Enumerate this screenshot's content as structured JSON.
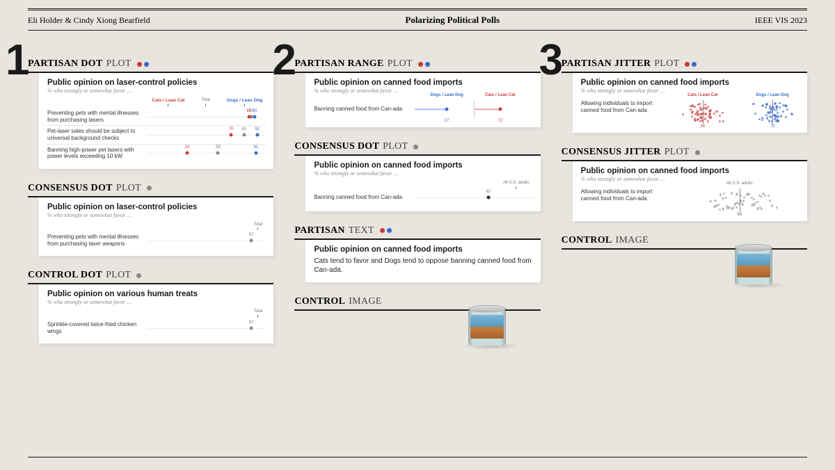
{
  "header": {
    "authors": "Eli Holder & Cindy Xiong Bearfield",
    "title": "Polarizing Political Polls",
    "venue": "IEEE VIS 2023"
  },
  "legend": {
    "red": "Cats / Lean Cat",
    "blue": "Dogs / Lean Dog",
    "total": "Total",
    "all_adults": "All U.S. adults"
  },
  "subtext": "% who strongly or somewhat favor …",
  "col1": {
    "num": "1",
    "s1": {
      "title_bold": "PARTISAN DOT",
      "title_light": "PLOT",
      "card_title": "Public opinion on laser-control policies",
      "rows": [
        {
          "label": "Preventing pets with mental illnesses from purchasing lasers",
          "red": 85,
          "blue": 90,
          "grey": 87
        },
        {
          "label": "Pet-laser sales should be subject to universal background checks",
          "red": 70,
          "blue": 92,
          "grey": 81
        },
        {
          "label": "Banning high-power pet lasers with power levels exceeding 10 kW",
          "red": 33,
          "blue": 91,
          "grey": 59
        }
      ]
    },
    "s2": {
      "title_bold": "CONSENSUS DOT",
      "title_light": "PLOT",
      "card_title": "Public opinion on laser-control policies",
      "row": {
        "label": "Preventing pets with mental illnesses from purchasing laser weapons",
        "grey": 87
      }
    },
    "s3": {
      "title_bold": "CONTROL DOT",
      "title_light": "PLOT",
      "card_title": "Public opinion on various human treats",
      "row": {
        "label": "Sprinkle-covered twice-fried chicken wings",
        "grey": 87
      }
    }
  },
  "col2": {
    "num": "2",
    "s1": {
      "title_bold": "PARTISAN RANGE",
      "title_light": "PLOT",
      "card_title": "Public opinion on canned food imports",
      "row": {
        "label": "Banning canned food from Can-ada",
        "red": 72,
        "blue": 27
      }
    },
    "s2": {
      "title_bold": "CONSENSUS DOT",
      "title_light": "PLOT",
      "card_title": "Public opinion on canned food imports",
      "row": {
        "label": "Banning canned food from Can-ada",
        "grey": 62
      }
    },
    "s3": {
      "title_bold": "PARTISAN",
      "title_light": "TEXT",
      "card_title": "Public opinion on canned food imports",
      "text": "Cats tend to favor and Dogs tend to oppose banning canned food from Can-ada."
    },
    "s4": {
      "title_bold": "CONTROL",
      "title_light": "IMAGE"
    }
  },
  "col3": {
    "num": "3",
    "s1": {
      "title_bold": "PARTISAN JITTER",
      "title_light": "PLOT",
      "card_title": "Public opinion on canned food imports",
      "row": {
        "label": "Allowing individuals to import canned food from Can-ada",
        "red": 26,
        "blue": 79
      }
    },
    "s2": {
      "title_bold": "CONSENSUS JITTER",
      "title_light": "PLOT",
      "card_title": "Public opinion on canned food imports",
      "row": {
        "label": "Allowing individuals to import canned food from Can-ada",
        "grey": 54
      }
    },
    "s3": {
      "title_bold": "CONTROL",
      "title_light": "IMAGE"
    }
  },
  "chart_data": [
    {
      "type": "scatter",
      "name": "Partisan Dot Plot – laser-control",
      "title": "Public opinion on laser-control policies",
      "ylabel": "",
      "xlabel": "% who strongly or somewhat favor",
      "xlim": [
        0,
        100
      ],
      "categories": [
        "Preventing pets with mental illnesses from purchasing lasers",
        "Pet-laser sales should be subject to universal background checks",
        "Banning high-power pet lasers with power levels exceeding 10 kW"
      ],
      "series": [
        {
          "name": "Cats / Lean Cat",
          "values": [
            85,
            70,
            33
          ]
        },
        {
          "name": "Dogs / Lean Dog",
          "values": [
            90,
            92,
            91
          ]
        },
        {
          "name": "Total",
          "values": [
            87,
            81,
            59
          ]
        }
      ]
    },
    {
      "type": "scatter",
      "name": "Consensus Dot Plot – laser-control",
      "title": "Public opinion on laser-control policies",
      "xlim": [
        0,
        100
      ],
      "categories": [
        "Preventing pets with mental illnesses from purchasing laser weapons"
      ],
      "series": [
        {
          "name": "Total",
          "values": [
            87
          ]
        }
      ]
    },
    {
      "type": "scatter",
      "name": "Control Dot Plot – human treats",
      "title": "Public opinion on various human treats",
      "xlim": [
        0,
        100
      ],
      "categories": [
        "Sprinkle-covered twice-fried chicken wings"
      ],
      "series": [
        {
          "name": "Total",
          "values": [
            87
          ]
        }
      ]
    },
    {
      "type": "bar",
      "name": "Partisan Range Plot – canned food",
      "title": "Public opinion on canned food imports",
      "xlim": [
        0,
        100
      ],
      "categories": [
        "Banning canned food from Can-ada"
      ],
      "series": [
        {
          "name": "Dogs / Lean Dog",
          "values": [
            27
          ]
        },
        {
          "name": "Cats / Lean Cat",
          "values": [
            72
          ]
        }
      ]
    },
    {
      "type": "scatter",
      "name": "Consensus Dot Plot – canned food",
      "title": "Public opinion on canned food imports",
      "xlim": [
        0,
        100
      ],
      "categories": [
        "Banning canned food from Can-ada"
      ],
      "series": [
        {
          "name": "All U.S. adults",
          "values": [
            62
          ]
        }
      ]
    },
    {
      "type": "scatter",
      "name": "Partisan Jitter Plot – canned food",
      "title": "Public opinion on canned food imports",
      "xlim": [
        0,
        100
      ],
      "categories": [
        "Allowing individuals to import canned food from Can-ada"
      ],
      "series": [
        {
          "name": "Cats / Lean Cat",
          "values": [
            26
          ]
        },
        {
          "name": "Dogs / Lean Dog",
          "values": [
            79
          ]
        }
      ]
    },
    {
      "type": "scatter",
      "name": "Consensus Jitter Plot – canned food",
      "title": "Public opinion on canned food imports",
      "xlim": [
        0,
        100
      ],
      "categories": [
        "Allowing individuals to import canned food from Can-ada"
      ],
      "series": [
        {
          "name": "All U.S. adults",
          "values": [
            54
          ]
        }
      ]
    }
  ]
}
